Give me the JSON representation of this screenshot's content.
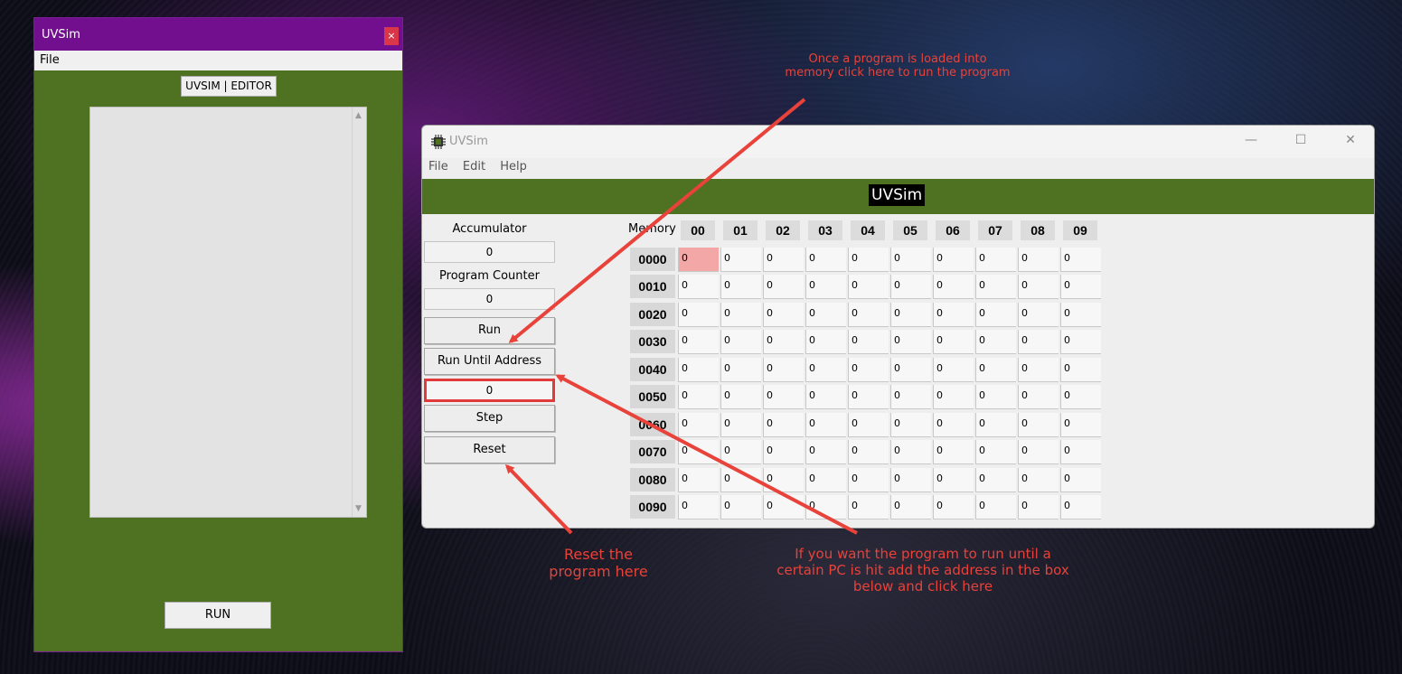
{
  "editor": {
    "title": "UVSim",
    "close_label": "×",
    "menu": [
      "File"
    ],
    "label": "UVSIM | EDITOR",
    "text": "",
    "run_label": "RUN"
  },
  "main": {
    "title": "UVSim",
    "menu": [
      "File",
      "Edit",
      "Help"
    ],
    "banner_title": "UVSim",
    "window_controls": {
      "minimize": "—",
      "maximize": "☐",
      "close": "✕"
    },
    "accumulator_label": "Accumulator",
    "accumulator_value": "0",
    "program_counter_label": "Program Counter",
    "program_counter_value": "0",
    "run_label": "Run",
    "run_until_label": "Run Until Address",
    "run_until_value": "0",
    "step_label": "Step",
    "reset_label": "Reset"
  },
  "memory": {
    "label": "Memory",
    "columns": [
      "00",
      "01",
      "02",
      "03",
      "04",
      "05",
      "06",
      "07",
      "08",
      "09"
    ],
    "rows": [
      {
        "addr": "0000",
        "values": [
          "0",
          "0",
          "0",
          "0",
          "0",
          "0",
          "0",
          "0",
          "0",
          "0"
        ]
      },
      {
        "addr": "0010",
        "values": [
          "0",
          "0",
          "0",
          "0",
          "0",
          "0",
          "0",
          "0",
          "0",
          "0"
        ]
      },
      {
        "addr": "0020",
        "values": [
          "0",
          "0",
          "0",
          "0",
          "0",
          "0",
          "0",
          "0",
          "0",
          "0"
        ]
      },
      {
        "addr": "0030",
        "values": [
          "0",
          "0",
          "0",
          "0",
          "0",
          "0",
          "0",
          "0",
          "0",
          "0"
        ]
      },
      {
        "addr": "0040",
        "values": [
          "0",
          "0",
          "0",
          "0",
          "0",
          "0",
          "0",
          "0",
          "0",
          "0"
        ]
      },
      {
        "addr": "0050",
        "values": [
          "0",
          "0",
          "0",
          "0",
          "0",
          "0",
          "0",
          "0",
          "0",
          "0"
        ]
      },
      {
        "addr": "0060",
        "values": [
          "0",
          "0",
          "0",
          "0",
          "0",
          "0",
          "0",
          "0",
          "0",
          "0"
        ]
      },
      {
        "addr": "0070",
        "values": [
          "0",
          "0",
          "0",
          "0",
          "0",
          "0",
          "0",
          "0",
          "0",
          "0"
        ]
      },
      {
        "addr": "0080",
        "values": [
          "0",
          "0",
          "0",
          "0",
          "0",
          "0",
          "0",
          "0",
          "0",
          "0"
        ]
      },
      {
        "addr": "0090",
        "values": [
          "0",
          "0",
          "0",
          "0",
          "0",
          "0",
          "0",
          "0",
          "0",
          "0"
        ]
      }
    ],
    "active_cell": "0000-00"
  },
  "annotations": {
    "run": [
      "Once a program is loaded into",
      "memory click here to run the program"
    ],
    "reset": [
      "Reset the",
      "program here"
    ],
    "run_until": [
      "If you want the program to run until a",
      "certain PC is hit add the address in the box",
      "below and click here"
    ]
  },
  "colors": {
    "editor_titlebar": "#720f8f",
    "banner": "#4e7122",
    "annotation": "#e8423a",
    "active_cell": "#f4a7a7"
  }
}
